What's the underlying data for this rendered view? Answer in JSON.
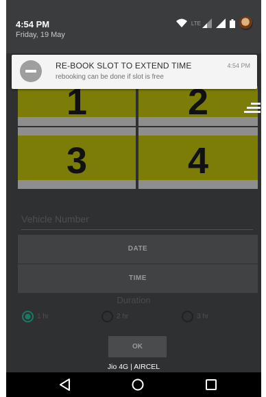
{
  "status_bar": {
    "time": "4:54 PM",
    "date": "Friday, 19 May",
    "network_label": "LTE",
    "icons": [
      "wifi-icon",
      "signal-icon",
      "signal-icon",
      "battery-icon",
      "avatar"
    ]
  },
  "notification": {
    "title": "RE-BOOK SLOT TO EXTEND TIME",
    "text": "rebooking can be done if slot is free",
    "time": "4:54 PM",
    "icon": "minus-circle-icon"
  },
  "slots": [
    {
      "label": "1"
    },
    {
      "label": "2"
    },
    {
      "label": "3"
    },
    {
      "label": "4"
    }
  ],
  "form": {
    "vehicle_placeholder": "Vehicle Number",
    "date_label": "DATE",
    "time_label": "TIME",
    "duration_label": "Duration",
    "durations": [
      {
        "label": "1 hr",
        "selected": true
      },
      {
        "label": "2 hr",
        "selected": false
      },
      {
        "label": "3 hr",
        "selected": false
      }
    ],
    "ok_label": "OK"
  },
  "carrier": "Jio 4G | AIRCEL",
  "nav": {
    "icons": [
      "back-icon",
      "home-icon",
      "recents-icon"
    ]
  },
  "colors": {
    "slot_fill": "#7b7d07",
    "accent": "#167a64",
    "background": "#2f3032"
  }
}
